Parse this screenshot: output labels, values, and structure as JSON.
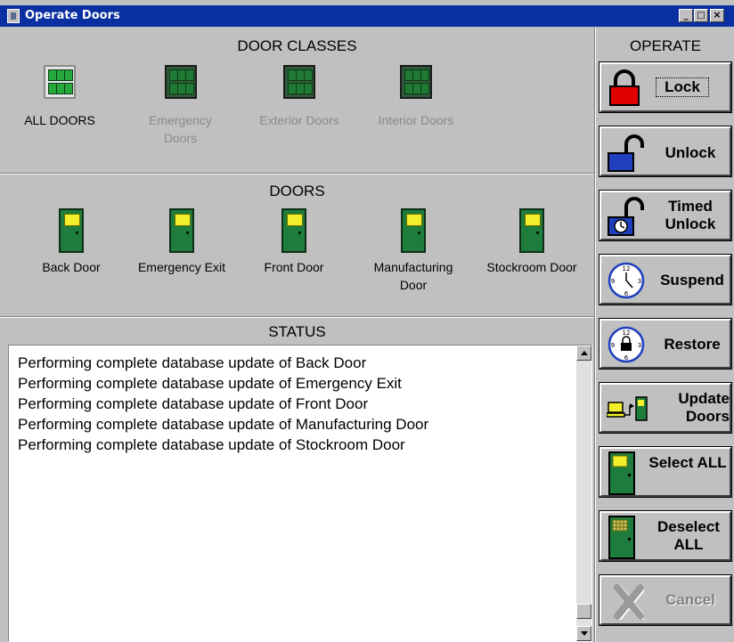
{
  "window": {
    "title": "Operate Doors",
    "minimize": "_",
    "restore": "□",
    "close": "×"
  },
  "door_classes": {
    "title": "DOOR CLASSES",
    "items": [
      {
        "label": "ALL DOORS",
        "active": true
      },
      {
        "label": "Emergency Doors",
        "active": false
      },
      {
        "label": "Exterior Doors",
        "active": false
      },
      {
        "label": "Interior Doors",
        "active": false
      }
    ]
  },
  "doors": {
    "title": "DOORS",
    "items": [
      {
        "label": "Back Door"
      },
      {
        "label": "Emergency Exit"
      },
      {
        "label": "Front Door"
      },
      {
        "label": "Manufacturing Door"
      },
      {
        "label": "Stockroom Door"
      }
    ]
  },
  "status": {
    "title": "STATUS",
    "lines": [
      "Performing complete database update of Back Door",
      "Performing complete database update of Emergency Exit",
      "Performing complete database update of Front Door",
      "Performing complete database update of Manufacturing Door",
      "Performing complete database update of Stockroom Door"
    ]
  },
  "operate": {
    "title": "OPERATE",
    "buttons": [
      {
        "label": "Lock",
        "enabled": true
      },
      {
        "label": "Unlock",
        "enabled": true
      },
      {
        "label": "Timed Unlock",
        "enabled": true
      },
      {
        "label": "Suspend",
        "enabled": true
      },
      {
        "label": "Restore",
        "enabled": true
      },
      {
        "label": "Update Doors",
        "enabled": true
      },
      {
        "label": "Select ALL",
        "enabled": true
      },
      {
        "label": "Deselect ALL",
        "enabled": true
      },
      {
        "label": "Cancel",
        "enabled": false
      }
    ]
  },
  "colors": {
    "titlebar": "#0a2fa0",
    "panel": "#c0c0c0",
    "door_green": "#1e7d3c",
    "door_window": "#f3ef2c",
    "lock_red": "#e00000",
    "unlock_blue": "#1f3fbf",
    "disabled_text": "#808080"
  },
  "icons": {
    "lock": "padlock-closed-red-icon",
    "unlock": "padlock-open-blue-icon",
    "timed_unlock": "padlock-clock-icon",
    "suspend": "clock-icon",
    "restore": "clock-lock-icon",
    "update": "computer-to-door-icon",
    "select": "door-icon",
    "deselect": "door-hatched-icon",
    "cancel": "x-icon"
  }
}
